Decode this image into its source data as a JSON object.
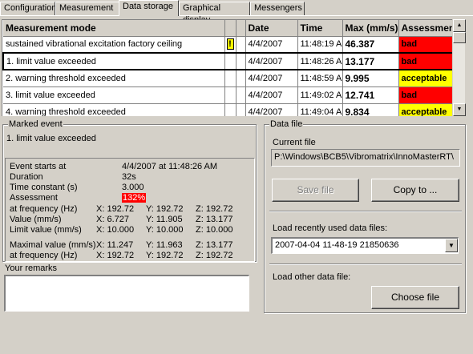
{
  "tabs": [
    "Configuration",
    "Measurement",
    "Data storage",
    "Graphical display",
    "Messengers"
  ],
  "table": {
    "headers": [
      "Measurement mode",
      "",
      "",
      "Date",
      "Time",
      "Max (mm/s)",
      "Assessment"
    ],
    "rows": [
      {
        "mode": "sustained vibrational excitation factory ceiling",
        "flag": "!",
        "date": "4/4/2007",
        "time": "11:48:19 A",
        "max": "46.387",
        "assessment": "bad",
        "color": "#ff0000"
      },
      {
        "mode": "1. limit value exceeded",
        "flag": "",
        "date": "4/4/2007",
        "time": "11:48:26 A",
        "max": "13.177",
        "assessment": "bad",
        "color": "#ff0000"
      },
      {
        "mode": "2. warning threshold exceeded",
        "flag": "",
        "date": "4/4/2007",
        "time": "11:48:59 A",
        "max": "9.995",
        "assessment": "acceptable",
        "color": "#ffff00"
      },
      {
        "mode": "3. limit value exceeded",
        "flag": "",
        "date": "4/4/2007",
        "time": "11:49:02 A",
        "max": "12.741",
        "assessment": "bad",
        "color": "#ff0000"
      },
      {
        "mode": "4. warning threshold exceeded",
        "flag": "",
        "date": "4/4/2007",
        "time": "11:49:04 A",
        "max": "9.834",
        "assessment": "acceptable",
        "color": "#ffff00"
      }
    ]
  },
  "marked_event": {
    "legend": "Marked event",
    "title": "1. limit value exceeded",
    "starts_label": "Event starts at",
    "starts_value": "4/4/2007 at 11:48:26 AM",
    "duration_label": "Duration",
    "duration_value": "32s",
    "tc_label": "Time constant (s)",
    "tc_value": "3.000",
    "assessment_label": "Assessment",
    "assessment_value": "132%",
    "freq_label": "at frequency (Hz)",
    "freq": [
      "X: 192.72",
      "Y: 192.72",
      "Z: 192.72"
    ],
    "value_label": "Value (mm/s)",
    "value": [
      "X: 6.727",
      "Y: 11.905",
      "Z: 13.177"
    ],
    "limit_label": "Limit value (mm/s)",
    "limit": [
      "X: 10.000",
      "Y: 10.000",
      "Z: 10.000"
    ],
    "max_label": "Maximal value (mm/s)",
    "max": [
      "X: 11.247",
      "Y: 11.963",
      "Z: 13.177"
    ],
    "freq2_label": "at frequency (Hz)",
    "freq2": [
      "X: 192.72",
      "Y: 192.72",
      "Z: 192.72"
    ],
    "remarks_label": "Your remarks"
  },
  "data_file": {
    "legend": "Data file",
    "current_label": "Current file",
    "current_path": "P:\\Windows\\BCB5\\Vibromatrix\\InnoMasterRT\\",
    "save_label": "Save file",
    "copy_label": "Copy to ...",
    "recent_label": "Load recently used data files:",
    "recent_value": "2007-04-04 11-48-19 21850636",
    "other_label": "Load other data file:",
    "choose_label": "Choose file"
  }
}
